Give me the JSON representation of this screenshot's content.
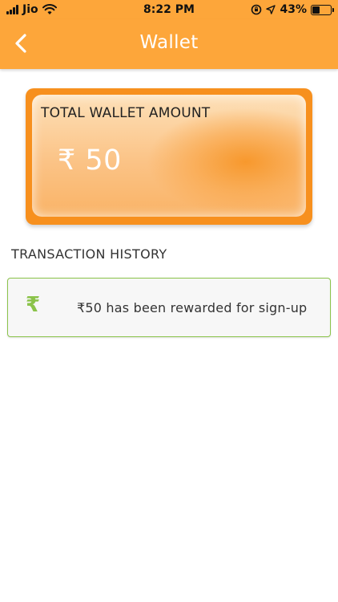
{
  "status_bar": {
    "carrier": "Jio",
    "time": "8:22 PM",
    "battery": "43%",
    "battery_level": 0.43
  },
  "nav": {
    "title": "Wallet",
    "back_icon": "chevron-left-icon"
  },
  "wallet": {
    "label": "TOTAL WALLET AMOUNT",
    "amount": "₹ 50"
  },
  "transactions": {
    "section_title": "TRANSACTION HISTORY",
    "items": [
      {
        "icon": "₹",
        "text": "₹50 has been rewarded for sign-up"
      }
    ]
  },
  "colors": {
    "brand_orange": "#fda63a",
    "card_orange": "#f7901e",
    "success_green": "#8bc34a"
  }
}
